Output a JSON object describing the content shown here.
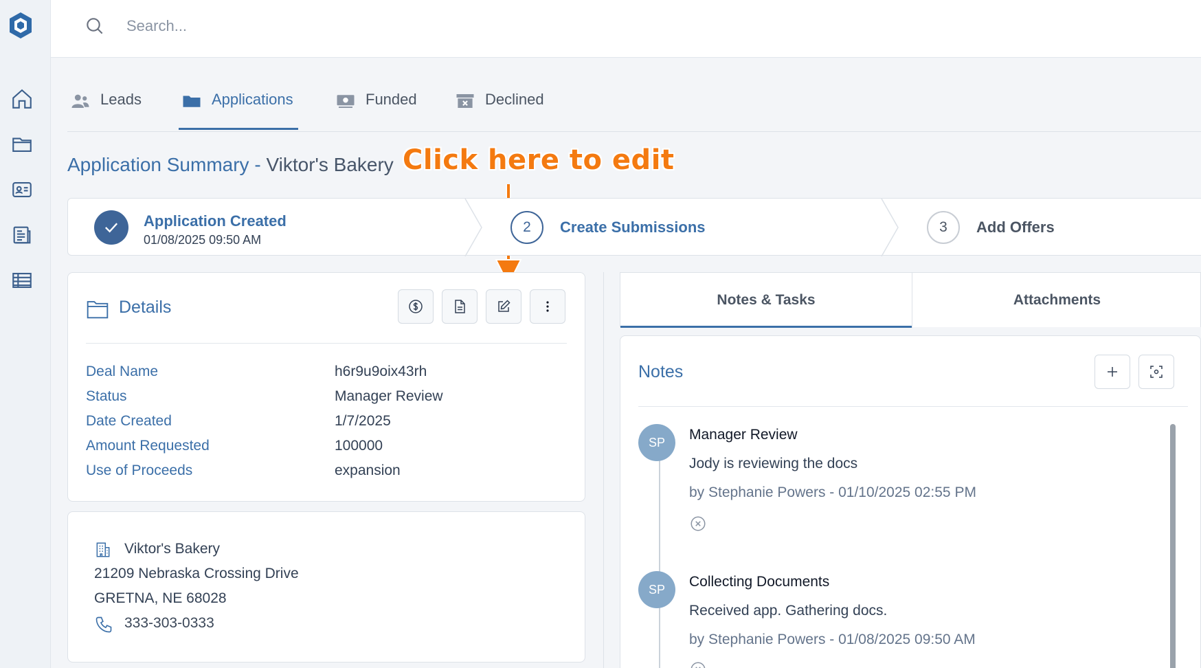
{
  "search": {
    "placeholder": "Search..."
  },
  "tabs": [
    {
      "label": "Leads",
      "icon": "users-icon"
    },
    {
      "label": "Applications",
      "icon": "folder-icon"
    },
    {
      "label": "Funded",
      "icon": "money-icon"
    },
    {
      "label": "Declined",
      "icon": "archive-x-icon"
    }
  ],
  "active_tab": "Applications",
  "title": {
    "prefix": "Application Summary",
    "separator": "-",
    "business": "Viktor's Bakery"
  },
  "callout": {
    "text": "Click here to edit"
  },
  "steps": [
    {
      "label": "Application Created",
      "sub": "01/08/2025 09:50 AM",
      "state": "done"
    },
    {
      "number": "2",
      "label": "Create Submissions",
      "state": "current"
    },
    {
      "number": "3",
      "label": "Add Offers",
      "state": "future"
    }
  ],
  "details": {
    "title": "Details",
    "fields": [
      {
        "label": "Deal Name",
        "value": "h6r9u9oix43rh"
      },
      {
        "label": "Status",
        "value": "Manager Review"
      },
      {
        "label": "Date Created",
        "value": "1/7/2025"
      },
      {
        "label": "Amount Requested",
        "value": "100000"
      },
      {
        "label": "Use of Proceeds",
        "value": "expansion"
      }
    ]
  },
  "address": {
    "business": "Viktor's Bakery",
    "street": "21209 Nebraska Crossing Drive",
    "city": "GRETNA, NE 68028",
    "phone": "333-303-0333"
  },
  "right_tabs": [
    {
      "label": "Notes & Tasks"
    },
    {
      "label": "Attachments"
    }
  ],
  "notes": {
    "title": "Notes",
    "items": [
      {
        "avatar": "SP",
        "title": "Manager Review",
        "body": "Jody is reviewing the docs",
        "meta": "by Stephanie Powers - 01/10/2025 02:55 PM"
      },
      {
        "avatar": "SP",
        "title": "Collecting Documents",
        "body": "Received app. Gathering docs.",
        "meta": "by Stephanie Powers - 01/08/2025 09:50 AM"
      }
    ]
  },
  "colors": {
    "primary": "#3b6fa8",
    "callout": "#f47a10",
    "avatar": "#86a9c9"
  }
}
